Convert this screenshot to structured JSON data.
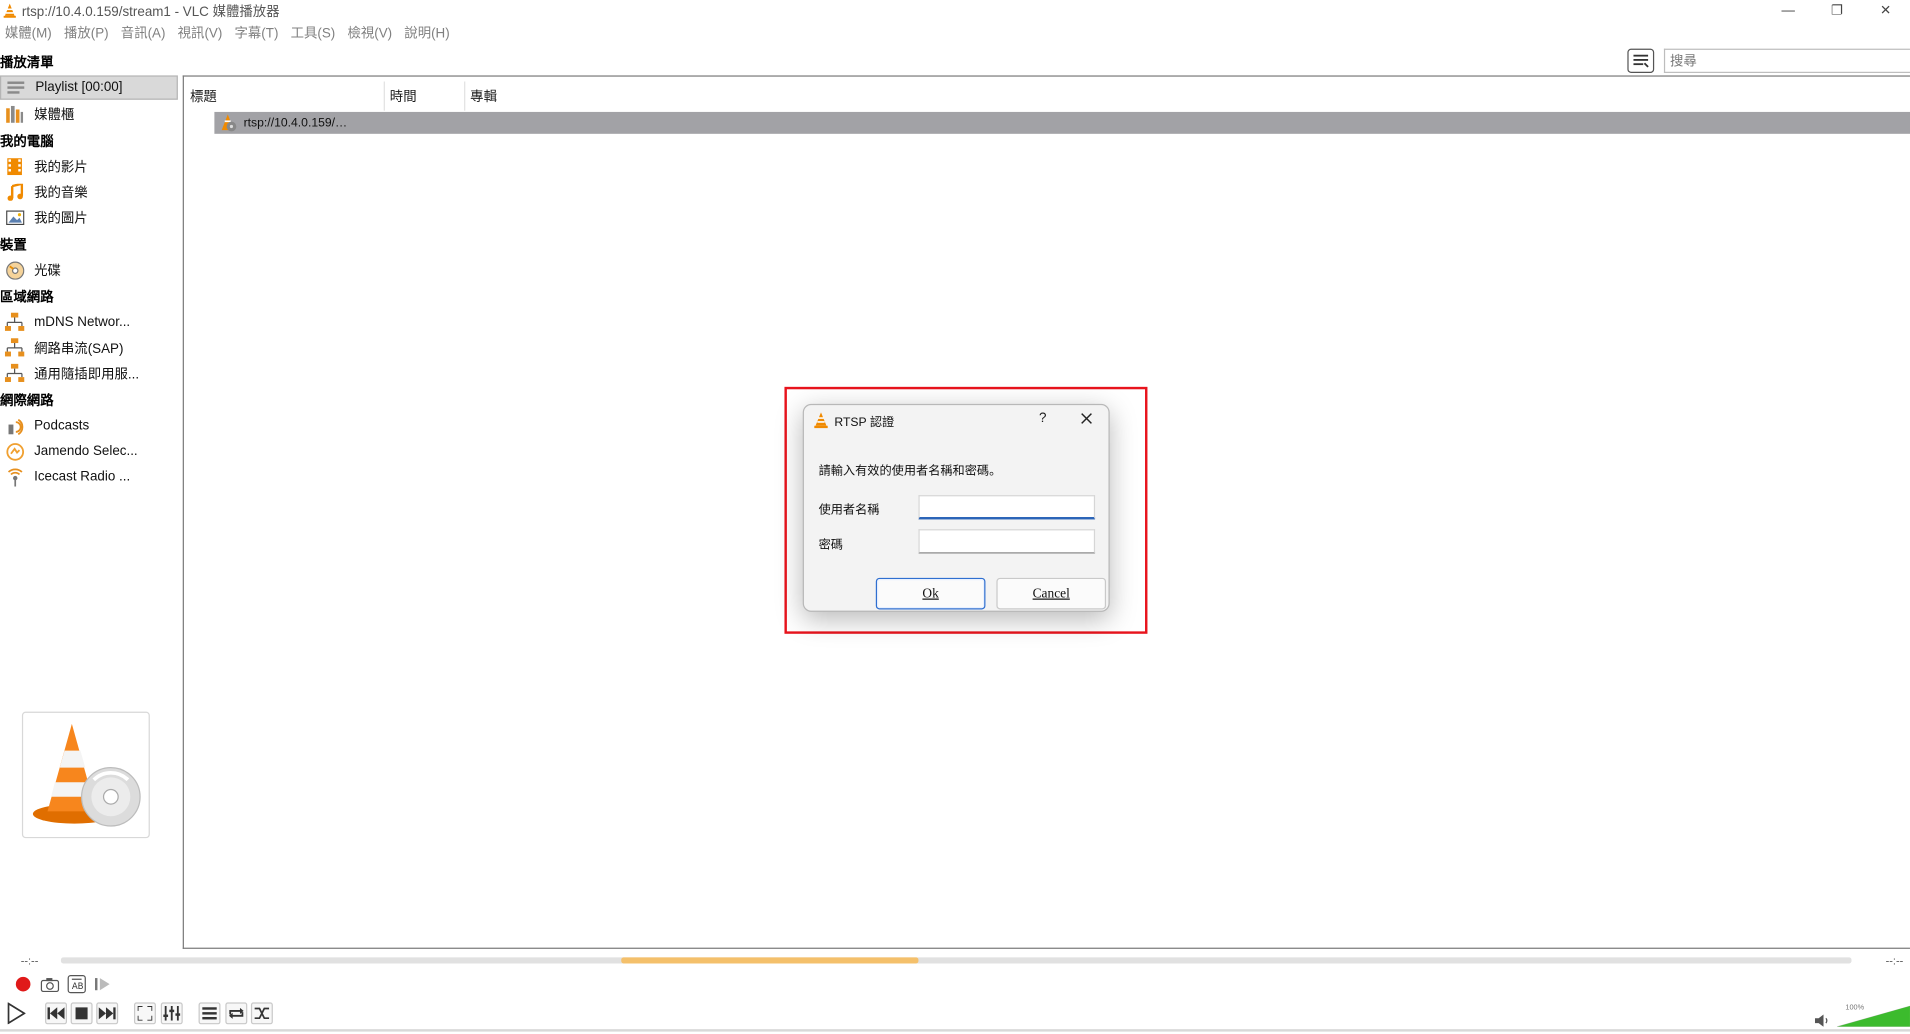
{
  "window": {
    "title": "rtsp://10.4.0.159/stream1 - VLC 媒體播放器",
    "minimize": "—",
    "maximize": "❐",
    "close": "✕"
  },
  "menu": [
    "媒體(M)",
    "播放(P)",
    "音訊(A)",
    "視訊(V)",
    "字幕(T)",
    "工具(S)",
    "檢視(V)",
    "說明(H)"
  ],
  "sidebar": {
    "playlist_header": "播放清單",
    "playlist_item": "Playlist [00:00]",
    "media_library": "媒體櫃",
    "my_computer": "我的電腦",
    "my_videos": "我的影片",
    "my_music": "我的音樂",
    "my_pictures": "我的圖片",
    "devices": "裝置",
    "disc": "光碟",
    "local_network": "區域網路",
    "mdns": "mDNS Networ...",
    "sap": "網路串流(SAP)",
    "upnp": "通用隨插即用服...",
    "internet": "網際網路",
    "podcasts": "Podcasts",
    "jamendo": "Jamendo Selec...",
    "icecast": "Icecast Radio ..."
  },
  "search": {
    "placeholder": "搜尋"
  },
  "playlist": {
    "columns": [
      "標題",
      "時間",
      "專輯"
    ],
    "rows": [
      {
        "title": "rtsp://10.4.0.159/…"
      }
    ]
  },
  "dialog": {
    "title": "RTSP 認證",
    "help": "?",
    "message": "請輸入有效的使用者名稱和密碼。",
    "username_label": "使用者名稱",
    "password_label": "密碼",
    "username_value": "",
    "password_value": "",
    "ok": "Ok",
    "cancel": "Cancel"
  },
  "player": {
    "elapsed": "--:--",
    "total": "--:--",
    "seek_highlight_fraction": 0.166,
    "volume_label": "100%",
    "volume_fraction": 1.0
  },
  "colors": {
    "vlc_orange": "#f08a00",
    "highlight_red": "#e8141d",
    "seek_fill": "#f4c06b",
    "volume_green": "#3cbb2d"
  }
}
